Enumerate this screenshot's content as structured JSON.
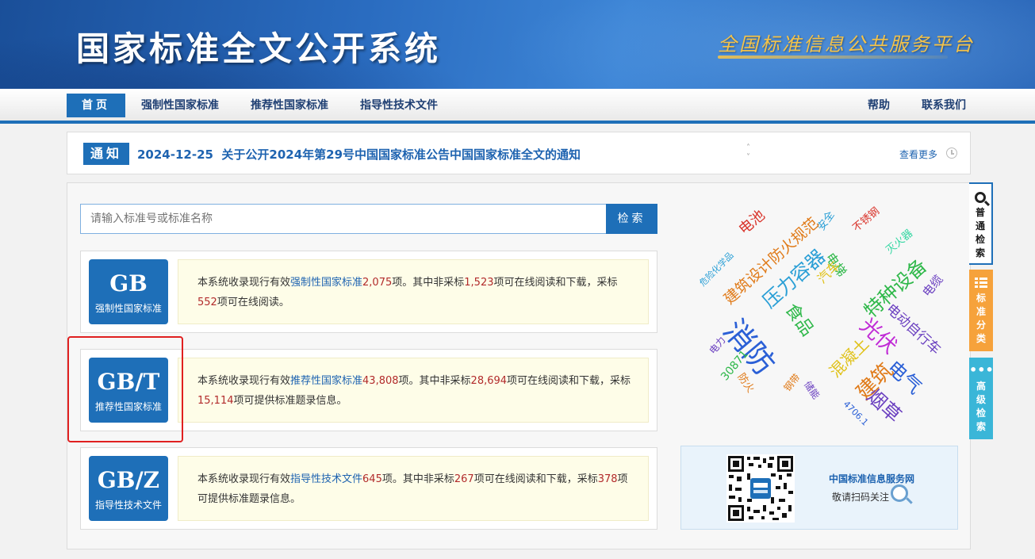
{
  "header": {
    "title": "国家标准全文公开系统",
    "slogan": "全国标准信息公共服务平台"
  },
  "nav": {
    "items": [
      {
        "label": "首页"
      },
      {
        "label": "强制性国家标准"
      },
      {
        "label": "推荐性国家标准"
      },
      {
        "label": "指导性技术文件"
      }
    ],
    "right_items": [
      {
        "label": "帮助"
      },
      {
        "label": "联系我们"
      }
    ]
  },
  "notice": {
    "badge": "通知",
    "date": "2024-12-25",
    "text": "关于公开2024年第29号中国国家标准公告中国国家标准全文的通知",
    "more": "查看更多"
  },
  "search": {
    "placeholder": "请输入标准号或标准名称",
    "button": "检索"
  },
  "standards": [
    {
      "code": "GB",
      "name": "强制性国家标准",
      "desc": {
        "p1": "本系统收录现行有效",
        "link": "强制性国家标准",
        "n1": "2,075",
        "p2": "项。其中非采标",
        "n2": "1,523",
        "p3": "项可在线阅读和下载，采标",
        "n3": "552",
        "p4": "项可在线阅读。"
      }
    },
    {
      "code": "GB/T",
      "name": "推荐性国家标准",
      "desc": {
        "p1": "本系统收录现行有效",
        "link": "推荐性国家标准",
        "n1": "43,808",
        "p2": "项。其中非采标",
        "n2": "28,694",
        "p3": "项可在线阅读和下载，采标",
        "n3": "15,114",
        "p4": "项可提供标准题录信息。"
      }
    },
    {
      "code": "GB/Z",
      "name": "指导性技术文件",
      "desc": {
        "p1": "本系统收录现行有效",
        "link": "指导性技术文件",
        "n1": "645",
        "p2": "项。其中非采标",
        "n2": "267",
        "p3": "项可在线阅读和下载，采标",
        "n3": "378",
        "p4": "项可提供标准题录信息。"
      }
    }
  ],
  "word_cloud": [
    {
      "text": "电池",
      "color": "#d9342b"
    },
    {
      "text": "安全",
      "color": "#2a9fd6"
    },
    {
      "text": "不锈钢",
      "color": "#d9342b"
    },
    {
      "text": "危险化学品",
      "color": "#2a9fd6"
    },
    {
      "text": "建筑设计防火规范",
      "color": "#e07b1a"
    },
    {
      "text": "压力容器",
      "color": "#2a9fd6"
    },
    {
      "text": "电梯",
      "color": "#2fb84a"
    },
    {
      "text": "灭火器",
      "color": "#2fd6a0"
    },
    {
      "text": "汽车",
      "color": "#e0c21a"
    },
    {
      "text": "特种设备",
      "color": "#2fb84a"
    },
    {
      "text": "电缆",
      "color": "#6a3fc0"
    },
    {
      "text": "食品",
      "color": "#2fb84a"
    },
    {
      "text": "消防",
      "color": "#2a5fd6"
    },
    {
      "text": "电动自行车",
      "color": "#6a3fc0"
    },
    {
      "text": "光伏",
      "color": "#c02ad6"
    },
    {
      "text": "电力",
      "color": "#6a3fc0"
    },
    {
      "text": "30871",
      "color": "#2fb84a"
    },
    {
      "text": "防火",
      "color": "#e07b1a"
    },
    {
      "text": "钢带",
      "color": "#e07b1a"
    },
    {
      "text": "混凝土",
      "color": "#e0c21a"
    },
    {
      "text": "建筑",
      "color": "#e07b1a"
    },
    {
      "text": "电气",
      "color": "#2a5fd6"
    },
    {
      "text": "储能",
      "color": "#6a3fc0"
    },
    {
      "text": "4706.1",
      "color": "#2a5fd6"
    },
    {
      "text": "烟草",
      "color": "#6a3fc0"
    }
  ],
  "qr": {
    "title": "中国标准信息服务网",
    "subtitle": "敬请扫码关注"
  },
  "side_tabs": [
    {
      "label": "普通检索",
      "icon": "search-icon"
    },
    {
      "label": "标准分类",
      "icon": "list-icon"
    },
    {
      "label": "高级检索",
      "icon": "dots-icon"
    }
  ],
  "colors": {
    "primary": "#1e6fb8",
    "accent_orange": "#f6a23b",
    "accent_cyan": "#3ab6d8",
    "number_red": "#b22b2b",
    "highlight_red": "#e02020"
  }
}
